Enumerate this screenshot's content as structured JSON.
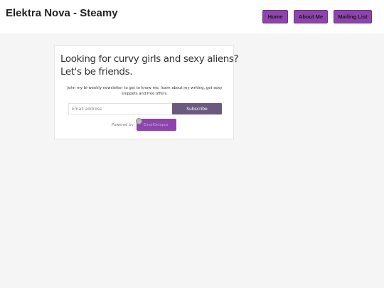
{
  "header": {
    "site_title": "Elektra Nova - Steamy",
    "nav": {
      "home": "Home",
      "about": "About Me",
      "mailing": "Mailing List"
    }
  },
  "signup": {
    "heading_line1": "Looking for curvy girls and sexy aliens?",
    "heading_line2": "Let's be friends.",
    "description": "John my bi-weekly newsletter to get to know me, learn about my writing, get sexy snippets and free offers.",
    "email_placeholder": "Email address",
    "subscribe_label": "Subscribe",
    "powered_by": "Powered by",
    "provider": "EmailOctopus"
  },
  "colors": {
    "accent": "#8e44ad",
    "subscribe": "#6b5a7e",
    "background": "#f5f5f5"
  },
  "icons": {
    "provider_logo": "emailoctopus-logo-icon"
  }
}
